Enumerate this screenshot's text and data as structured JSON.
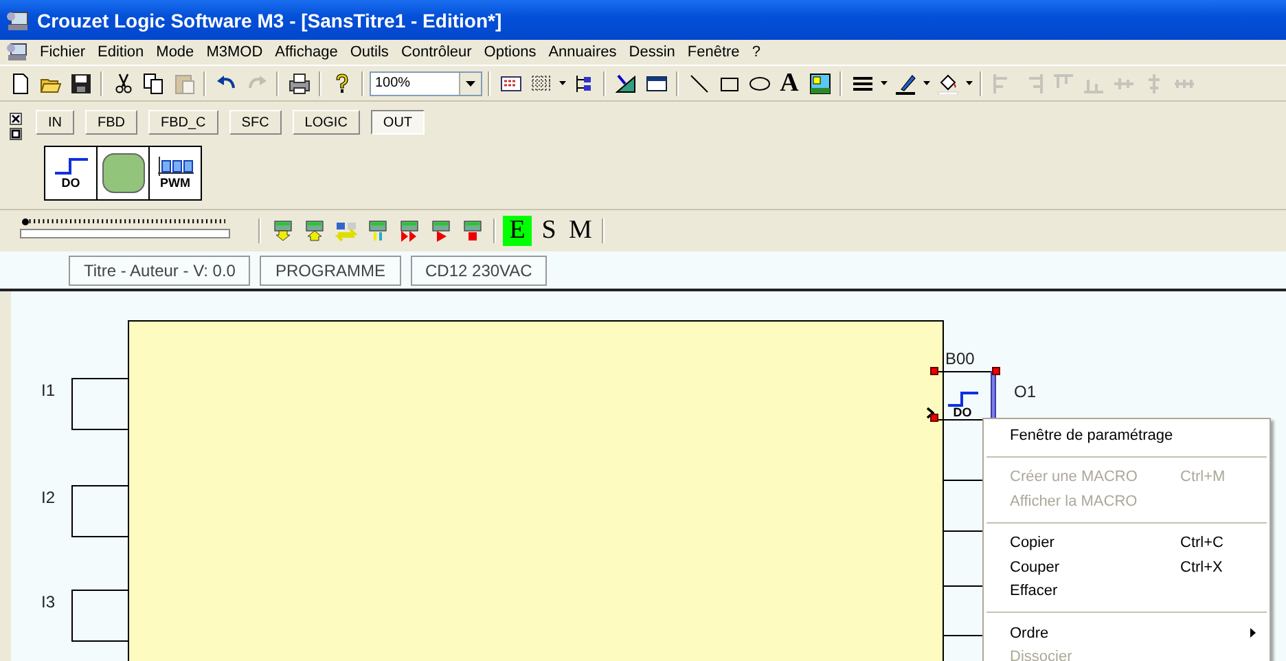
{
  "window": {
    "title": "Crouzet Logic Software M3 - [SansTitre1 - Edition*]"
  },
  "menu_bar": [
    "Fichier",
    "Edition",
    "Mode",
    "M3MOD",
    "Affichage",
    "Outils",
    "Contrôleur",
    "Options",
    "Annuaires",
    "Dessin",
    "Fenêtre",
    "?"
  ],
  "toolbar": {
    "zoom": "100%",
    "text_tool": "A"
  },
  "palette": {
    "tabs": [
      {
        "label": "IN",
        "selected": false
      },
      {
        "label": "FBD",
        "selected": false
      },
      {
        "label": "FBD_C",
        "selected": false
      },
      {
        "label": "SFC",
        "selected": false
      },
      {
        "label": "LOGIC",
        "selected": false
      },
      {
        "label": "OUT",
        "selected": true
      }
    ],
    "blocks": [
      {
        "kind": "digital_output",
        "label": "DO"
      },
      {
        "kind": "display"
      },
      {
        "kind": "pwm",
        "label": "PWM"
      }
    ]
  },
  "simulation_bar": {
    "speed_slider": {
      "level": 0
    },
    "modes": [
      {
        "label": "E",
        "selected": true
      },
      {
        "label": "S",
        "selected": false
      },
      {
        "label": "M",
        "selected": false
      }
    ]
  },
  "status_fields": [
    "Titre - Auteur - V: 0.0",
    "PROGRAMME",
    "CD12 230VAC"
  ],
  "diagram": {
    "inputs": [
      {
        "label": "I1"
      },
      {
        "label": "I2"
      },
      {
        "label": "I3"
      }
    ],
    "output_block": {
      "name": "B00",
      "type": "DO",
      "output": "O1",
      "selected": true
    }
  },
  "context_menu": [
    {
      "kind": "item",
      "label": "Fenêtre de paramétrage",
      "disabled": false
    },
    {
      "kind": "separator"
    },
    {
      "kind": "item",
      "label": "Créer une MACRO",
      "shortcut": "Ctrl+M",
      "disabled": true
    },
    {
      "kind": "item",
      "label": "Afficher la MACRO",
      "disabled": true
    },
    {
      "kind": "separator"
    },
    {
      "kind": "item",
      "label": "Copier",
      "shortcut": "Ctrl+C",
      "disabled": false
    },
    {
      "kind": "item",
      "label": "Couper",
      "shortcut": "Ctrl+X",
      "disabled": false
    },
    {
      "kind": "item",
      "label": "Effacer",
      "disabled": false
    },
    {
      "kind": "separator"
    },
    {
      "kind": "submenu",
      "label": "Ordre",
      "disabled": false
    },
    {
      "kind": "item",
      "label": "Dissocier",
      "disabled": true
    }
  ]
}
